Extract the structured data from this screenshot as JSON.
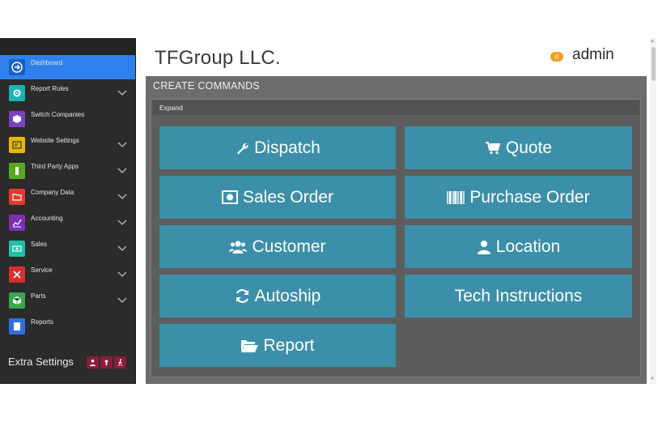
{
  "sidebar": {
    "items": [
      {
        "label": "Dashboard",
        "icon": "arrow-right-circle-icon",
        "color": "#2f80ed",
        "active": true,
        "chevron": false
      },
      {
        "label": "Report Rules",
        "icon": "gear-icon",
        "color": "#19b5b0",
        "chevron": true
      },
      {
        "label": "Switch Companies",
        "icon": "box-icon",
        "color": "#7b3fc4",
        "chevron": false
      },
      {
        "label": "Website Settings",
        "icon": "browser-icon",
        "color": "#e9b800",
        "chevron": true
      },
      {
        "label": "Third Party Apps",
        "icon": "person-icon",
        "color": "#5aa820",
        "chevron": true
      },
      {
        "label": "Company Data",
        "icon": "folder-icon",
        "color": "#e23b2e",
        "chevron": true
      },
      {
        "label": "Accounting",
        "icon": "chart-icon",
        "color": "#7d2fb0",
        "chevron": true
      },
      {
        "label": "Sales",
        "icon": "money-icon",
        "color": "#1fc0a8",
        "chevron": true
      },
      {
        "label": "Service",
        "icon": "tools-icon",
        "color": "#d62f2f",
        "chevron": true
      },
      {
        "label": "Parts",
        "icon": "cube-icon",
        "color": "#39a94a",
        "chevron": true
      },
      {
        "label": "Reports",
        "icon": "document-icon",
        "color": "#2f6fe0",
        "chevron": false
      }
    ],
    "extra_settings": "Extra Settings"
  },
  "header": {
    "company": "TFGroup LLC.",
    "notification_count": "0",
    "user": "admin"
  },
  "panel": {
    "title": "CREATE COMMANDS",
    "expand_label": "Expand",
    "commands": [
      {
        "label": "Dispatch",
        "icon": "wrench-icon"
      },
      {
        "label": "Quote",
        "icon": "cart-icon"
      },
      {
        "label": "Sales Order",
        "icon": "money-icon"
      },
      {
        "label": "Purchase Order",
        "icon": "barcode-icon"
      },
      {
        "label": "Customer",
        "icon": "users-icon"
      },
      {
        "label": "Location",
        "icon": "user-icon"
      },
      {
        "label": "Autoship",
        "icon": "refresh-icon"
      },
      {
        "label": "Tech Instructions",
        "icon": ""
      },
      {
        "label": "Report",
        "icon": "folder-open-icon"
      }
    ]
  },
  "colors": {
    "accent": "#2f80ed",
    "button": "#3c8fa8",
    "badge": "#f0a020",
    "extra_buttons": "#8a1c3a"
  }
}
